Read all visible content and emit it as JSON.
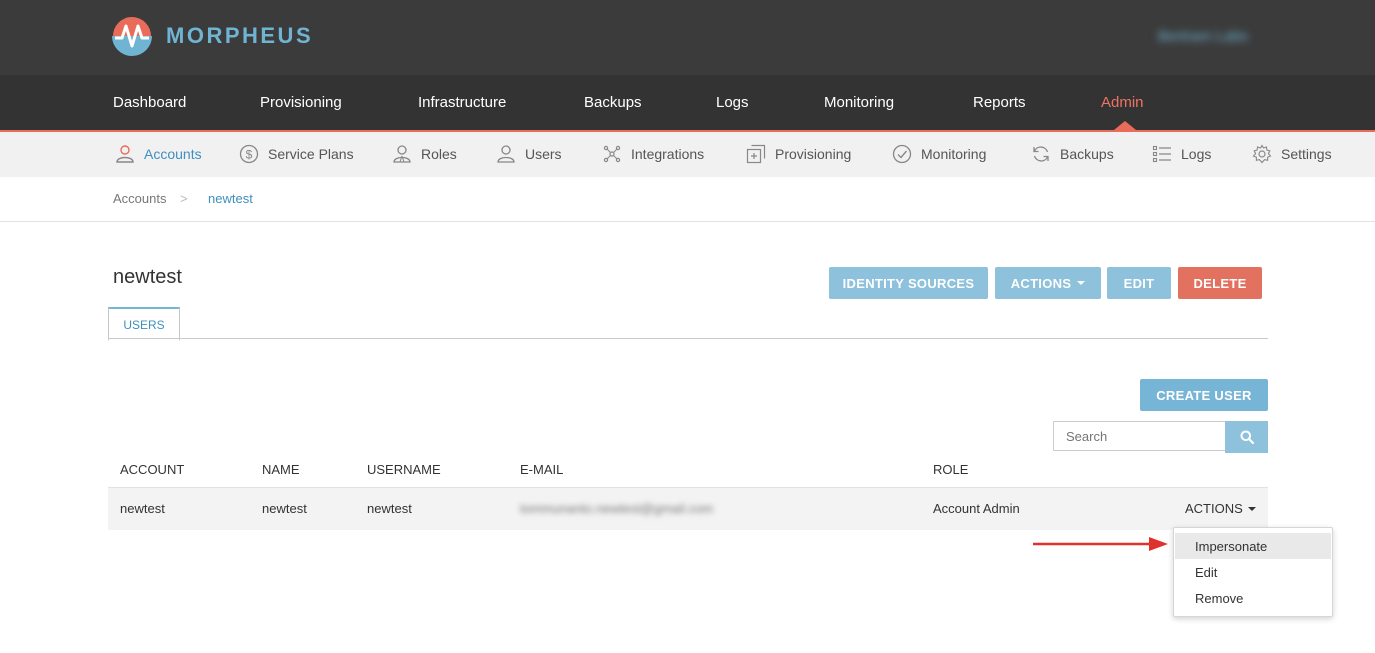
{
  "app": {
    "logo_text": "MORPHEUS",
    "user_name": "Bertram Labs"
  },
  "main_nav": [
    {
      "label": "Dashboard"
    },
    {
      "label": "Provisioning"
    },
    {
      "label": "Infrastructure"
    },
    {
      "label": "Backups"
    },
    {
      "label": "Logs"
    },
    {
      "label": "Monitoring"
    },
    {
      "label": "Reports"
    },
    {
      "label": "Admin",
      "active": true
    }
  ],
  "sub_nav": [
    {
      "label": "Accounts",
      "icon": "user-accounts-icon",
      "active": true
    },
    {
      "label": "Service Plans",
      "icon": "dollar-icon"
    },
    {
      "label": "Roles",
      "icon": "roles-icon"
    },
    {
      "label": "Users",
      "icon": "user-icon"
    },
    {
      "label": "Integrations",
      "icon": "integrations-icon"
    },
    {
      "label": "Provisioning",
      "icon": "provisioning-icon"
    },
    {
      "label": "Monitoring",
      "icon": "check-circle-icon"
    },
    {
      "label": "Backups",
      "icon": "refresh-icon"
    },
    {
      "label": "Logs",
      "icon": "list-icon"
    },
    {
      "label": "Settings",
      "icon": "gear-icon"
    }
  ],
  "breadcrumb": {
    "root": "Accounts",
    "separator": ">",
    "current": "newtest"
  },
  "page": {
    "title": "newtest",
    "buttons": {
      "identity_sources": "IDENTITY SOURCES",
      "actions": "ACTIONS",
      "edit": "EDIT",
      "delete": "DELETE"
    },
    "tabs": [
      {
        "label": "USERS"
      }
    ]
  },
  "users": {
    "create_button": "CREATE USER",
    "search": {
      "placeholder": "Search"
    },
    "columns": [
      "ACCOUNT",
      "NAME",
      "USERNAME",
      "E-MAIL",
      "ROLE"
    ],
    "rows": [
      {
        "account": "newtest",
        "name": "newtest",
        "username": "newtest",
        "email": "tommunanto.newtest@gmail.com",
        "role": "Account Admin",
        "actions_label": "ACTIONS"
      }
    ],
    "row_menu": [
      "Impersonate",
      "Edit",
      "Remove"
    ]
  },
  "colors": {
    "brand_blue": "#6fb5d3",
    "accent_red": "#e96c5b",
    "button_blue": "#8dc1dc",
    "button_red": "#e2725f",
    "annotation_arrow": "#e0312a"
  }
}
